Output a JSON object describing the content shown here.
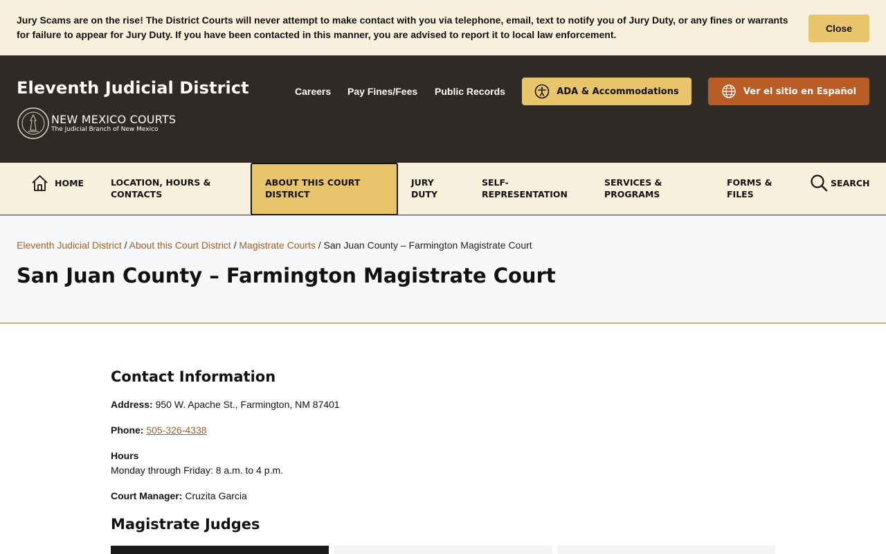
{
  "alert": {
    "message": "Jury Scams are on the rise! The District Courts will never attempt to make contact with you via telephone, email, text to notify you of Jury Duty, or any fines or warrants for failure to appear for Jury Duty. If you have been contacted in this manner, you are advised to report it to local law enforcement.",
    "close_label": "Close"
  },
  "header": {
    "site_title": "Eleventh Judicial District",
    "logo_main": "NEW MEXICO COURTS",
    "logo_sub": "The Judicial Branch of New Mexico",
    "links": [
      "Careers",
      "Pay Fines/Fees",
      "Public Records"
    ],
    "ada_label": "ADA & Accommodations",
    "spanish_label": "Ver el sitio en Español",
    "colors": {
      "bg": "#302a26",
      "gold": "#e8c46a",
      "orange": "#b95c25"
    }
  },
  "nav": {
    "home": "HOME",
    "location": [
      "LOCATION, HOURS &",
      "CONTACTS"
    ],
    "about": [
      "ABOUT THIS COURT",
      "DISTRICT"
    ],
    "jury": [
      "JURY",
      "DUTY"
    ],
    "self_rep": [
      "SELF-",
      "REPRESENTATION"
    ],
    "services": [
      "SERVICES &",
      "PROGRAMS"
    ],
    "forms": [
      "FORMS &",
      "FILES"
    ],
    "search": "SEARCH"
  },
  "breadcrumb": {
    "items": [
      "Eleventh Judicial District",
      "About this Court District",
      "Magistrate Courts"
    ],
    "separator": " / ",
    "current": "San Juan County – Farmington Magistrate Court"
  },
  "page_title": "San Juan County – Farmington Magistrate Court",
  "contact": {
    "heading": "Contact Information",
    "address_label": "Address:",
    "address": " 950 W. Apache St., Farmington, NM 87401",
    "phone_label": "Phone:",
    "phone": "505-326-4338",
    "hours_label": "Hours",
    "hours": "Monday through Friday: 8 a.m. to 4 p.m.",
    "manager_label": "Court Manager:",
    "manager": " Cruzita Garcia"
  },
  "judges": {
    "heading": "Magistrate Judges"
  }
}
